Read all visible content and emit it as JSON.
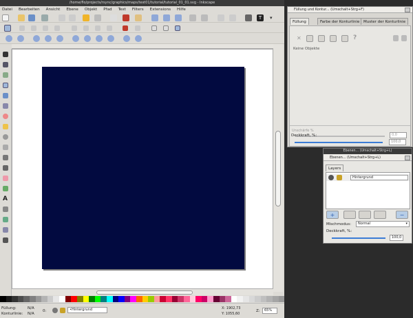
{
  "main_window": {
    "title": "/home/flo/projects/rsync/graphics/maps/test01/tutorial/tutorial_01_01.svg - Inkscape",
    "menu": [
      "Datei",
      "Bearbeiten",
      "Ansicht",
      "Ebene",
      "Objekt",
      "Pfad",
      "Text",
      "Filters",
      "Extensions",
      "Hilfe"
    ]
  },
  "canvas": {
    "page_color": "#020a40"
  },
  "statusbar": {
    "fill_label": "Füllung:",
    "fill_value": "N/A",
    "stroke_label": "Konturlinie:",
    "stroke_value": "N/A",
    "opacity_value": "0:",
    "layer_selector": "•Hintergrund",
    "coord_x": "X: 1902,73",
    "coord_y": "Y: 1055,60",
    "zoom_label": "Z:",
    "zoom_value": "65%"
  },
  "fill_stroke_panel": {
    "title": "Füllung und Kontur... (Umschalt+Strg+F)",
    "tabs": [
      "Füllung",
      "Farbe der Konturlinie",
      "Muster der Konturlinie"
    ],
    "no_objects": "Keine Objekte",
    "blur_label": "Unschärfe %",
    "blur_value": "0,0",
    "opacity_label": "Deckkraft, %:",
    "opacity_value": "100,0"
  },
  "layers_panel": {
    "title": "Ebenen... (Umschalt+Strg+L)",
    "subtitle": "Ebenen... (Umschalt+Strg+L)",
    "tab": "Layers",
    "layer_name": "Hintergrund",
    "blend_label": "Mischmodus:",
    "blend_value": "Normal",
    "opacity_label": "Deckkraft, %:",
    "opacity_value": "100,0"
  },
  "palette_colors": [
    "#000000",
    "#1a1a1a",
    "#333333",
    "#4d4d4d",
    "#666666",
    "#808080",
    "#999999",
    "#b3b3b3",
    "#cccccc",
    "#e6e6e6",
    "#ffffff",
    "#800000",
    "#ff0000",
    "#808000",
    "#ffff00",
    "#008000",
    "#00ff00",
    "#008080",
    "#00ffff",
    "#000080",
    "#0000ff",
    "#800080",
    "#ff00ff",
    "#ff6600",
    "#ffcc00",
    "#99cc00",
    "#ff9999",
    "#cc0033",
    "#ff3366",
    "#990033",
    "#cc3366",
    "#ff6699",
    "#ffccdd",
    "#ff0066",
    "#cc0066",
    "#ff99cc",
    "#660033",
    "#993366",
    "#cc6699",
    "#ffffff",
    "#f2f2f2",
    "#e5e5e5",
    "#d8d8d8",
    "#cccccc",
    "#bfbfbf",
    "#b2b2b2",
    "#a5a5a5",
    "#999999"
  ]
}
